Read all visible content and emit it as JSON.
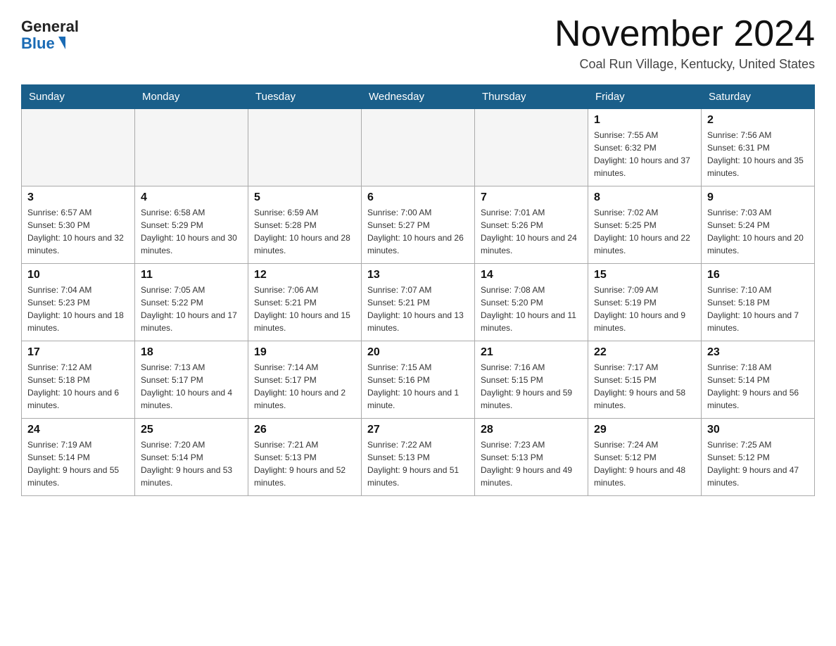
{
  "logo": {
    "general": "General",
    "blue": "Blue"
  },
  "title": "November 2024",
  "location": "Coal Run Village, Kentucky, United States",
  "days_of_week": [
    "Sunday",
    "Monday",
    "Tuesday",
    "Wednesday",
    "Thursday",
    "Friday",
    "Saturday"
  ],
  "weeks": [
    [
      {
        "day": "",
        "sunrise": "",
        "sunset": "",
        "daylight": "",
        "empty": true
      },
      {
        "day": "",
        "sunrise": "",
        "sunset": "",
        "daylight": "",
        "empty": true
      },
      {
        "day": "",
        "sunrise": "",
        "sunset": "",
        "daylight": "",
        "empty": true
      },
      {
        "day": "",
        "sunrise": "",
        "sunset": "",
        "daylight": "",
        "empty": true
      },
      {
        "day": "",
        "sunrise": "",
        "sunset": "",
        "daylight": "",
        "empty": true
      },
      {
        "day": "1",
        "sunrise": "Sunrise: 7:55 AM",
        "sunset": "Sunset: 6:32 PM",
        "daylight": "Daylight: 10 hours and 37 minutes.",
        "empty": false
      },
      {
        "day": "2",
        "sunrise": "Sunrise: 7:56 AM",
        "sunset": "Sunset: 6:31 PM",
        "daylight": "Daylight: 10 hours and 35 minutes.",
        "empty": false
      }
    ],
    [
      {
        "day": "3",
        "sunrise": "Sunrise: 6:57 AM",
        "sunset": "Sunset: 5:30 PM",
        "daylight": "Daylight: 10 hours and 32 minutes.",
        "empty": false
      },
      {
        "day": "4",
        "sunrise": "Sunrise: 6:58 AM",
        "sunset": "Sunset: 5:29 PM",
        "daylight": "Daylight: 10 hours and 30 minutes.",
        "empty": false
      },
      {
        "day": "5",
        "sunrise": "Sunrise: 6:59 AM",
        "sunset": "Sunset: 5:28 PM",
        "daylight": "Daylight: 10 hours and 28 minutes.",
        "empty": false
      },
      {
        "day": "6",
        "sunrise": "Sunrise: 7:00 AM",
        "sunset": "Sunset: 5:27 PM",
        "daylight": "Daylight: 10 hours and 26 minutes.",
        "empty": false
      },
      {
        "day": "7",
        "sunrise": "Sunrise: 7:01 AM",
        "sunset": "Sunset: 5:26 PM",
        "daylight": "Daylight: 10 hours and 24 minutes.",
        "empty": false
      },
      {
        "day": "8",
        "sunrise": "Sunrise: 7:02 AM",
        "sunset": "Sunset: 5:25 PM",
        "daylight": "Daylight: 10 hours and 22 minutes.",
        "empty": false
      },
      {
        "day": "9",
        "sunrise": "Sunrise: 7:03 AM",
        "sunset": "Sunset: 5:24 PM",
        "daylight": "Daylight: 10 hours and 20 minutes.",
        "empty": false
      }
    ],
    [
      {
        "day": "10",
        "sunrise": "Sunrise: 7:04 AM",
        "sunset": "Sunset: 5:23 PM",
        "daylight": "Daylight: 10 hours and 18 minutes.",
        "empty": false
      },
      {
        "day": "11",
        "sunrise": "Sunrise: 7:05 AM",
        "sunset": "Sunset: 5:22 PM",
        "daylight": "Daylight: 10 hours and 17 minutes.",
        "empty": false
      },
      {
        "day": "12",
        "sunrise": "Sunrise: 7:06 AM",
        "sunset": "Sunset: 5:21 PM",
        "daylight": "Daylight: 10 hours and 15 minutes.",
        "empty": false
      },
      {
        "day": "13",
        "sunrise": "Sunrise: 7:07 AM",
        "sunset": "Sunset: 5:21 PM",
        "daylight": "Daylight: 10 hours and 13 minutes.",
        "empty": false
      },
      {
        "day": "14",
        "sunrise": "Sunrise: 7:08 AM",
        "sunset": "Sunset: 5:20 PM",
        "daylight": "Daylight: 10 hours and 11 minutes.",
        "empty": false
      },
      {
        "day": "15",
        "sunrise": "Sunrise: 7:09 AM",
        "sunset": "Sunset: 5:19 PM",
        "daylight": "Daylight: 10 hours and 9 minutes.",
        "empty": false
      },
      {
        "day": "16",
        "sunrise": "Sunrise: 7:10 AM",
        "sunset": "Sunset: 5:18 PM",
        "daylight": "Daylight: 10 hours and 7 minutes.",
        "empty": false
      }
    ],
    [
      {
        "day": "17",
        "sunrise": "Sunrise: 7:12 AM",
        "sunset": "Sunset: 5:18 PM",
        "daylight": "Daylight: 10 hours and 6 minutes.",
        "empty": false
      },
      {
        "day": "18",
        "sunrise": "Sunrise: 7:13 AM",
        "sunset": "Sunset: 5:17 PM",
        "daylight": "Daylight: 10 hours and 4 minutes.",
        "empty": false
      },
      {
        "day": "19",
        "sunrise": "Sunrise: 7:14 AM",
        "sunset": "Sunset: 5:17 PM",
        "daylight": "Daylight: 10 hours and 2 minutes.",
        "empty": false
      },
      {
        "day": "20",
        "sunrise": "Sunrise: 7:15 AM",
        "sunset": "Sunset: 5:16 PM",
        "daylight": "Daylight: 10 hours and 1 minute.",
        "empty": false
      },
      {
        "day": "21",
        "sunrise": "Sunrise: 7:16 AM",
        "sunset": "Sunset: 5:15 PM",
        "daylight": "Daylight: 9 hours and 59 minutes.",
        "empty": false
      },
      {
        "day": "22",
        "sunrise": "Sunrise: 7:17 AM",
        "sunset": "Sunset: 5:15 PM",
        "daylight": "Daylight: 9 hours and 58 minutes.",
        "empty": false
      },
      {
        "day": "23",
        "sunrise": "Sunrise: 7:18 AM",
        "sunset": "Sunset: 5:14 PM",
        "daylight": "Daylight: 9 hours and 56 minutes.",
        "empty": false
      }
    ],
    [
      {
        "day": "24",
        "sunrise": "Sunrise: 7:19 AM",
        "sunset": "Sunset: 5:14 PM",
        "daylight": "Daylight: 9 hours and 55 minutes.",
        "empty": false
      },
      {
        "day": "25",
        "sunrise": "Sunrise: 7:20 AM",
        "sunset": "Sunset: 5:14 PM",
        "daylight": "Daylight: 9 hours and 53 minutes.",
        "empty": false
      },
      {
        "day": "26",
        "sunrise": "Sunrise: 7:21 AM",
        "sunset": "Sunset: 5:13 PM",
        "daylight": "Daylight: 9 hours and 52 minutes.",
        "empty": false
      },
      {
        "day": "27",
        "sunrise": "Sunrise: 7:22 AM",
        "sunset": "Sunset: 5:13 PM",
        "daylight": "Daylight: 9 hours and 51 minutes.",
        "empty": false
      },
      {
        "day": "28",
        "sunrise": "Sunrise: 7:23 AM",
        "sunset": "Sunset: 5:13 PM",
        "daylight": "Daylight: 9 hours and 49 minutes.",
        "empty": false
      },
      {
        "day": "29",
        "sunrise": "Sunrise: 7:24 AM",
        "sunset": "Sunset: 5:12 PM",
        "daylight": "Daylight: 9 hours and 48 minutes.",
        "empty": false
      },
      {
        "day": "30",
        "sunrise": "Sunrise: 7:25 AM",
        "sunset": "Sunset: 5:12 PM",
        "daylight": "Daylight: 9 hours and 47 minutes.",
        "empty": false
      }
    ]
  ]
}
